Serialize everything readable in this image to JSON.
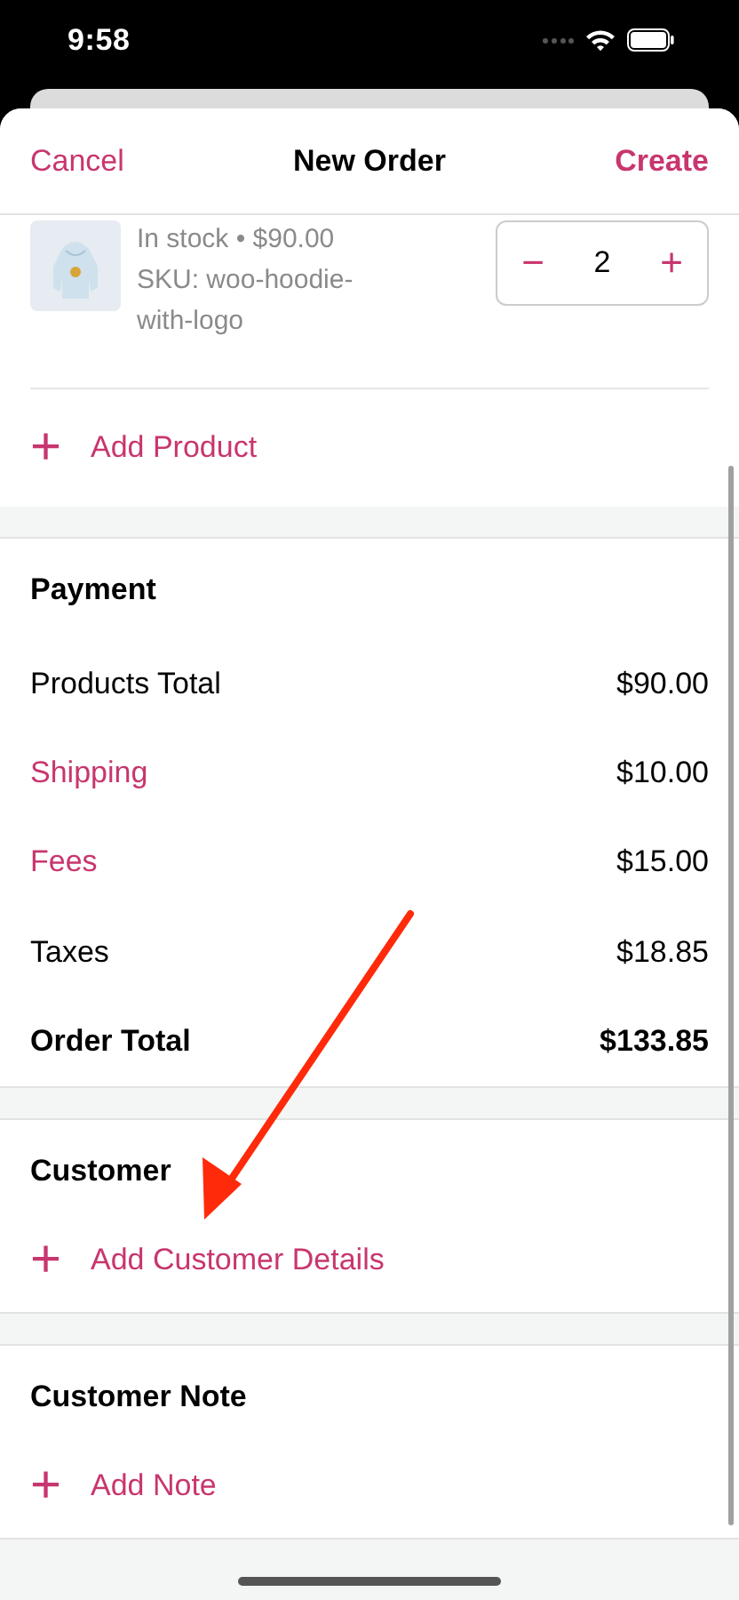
{
  "status_bar": {
    "time": "9:58"
  },
  "header": {
    "cancel": "Cancel",
    "title": "New Order",
    "create": "Create"
  },
  "product": {
    "stock": "In stock • $90.00",
    "sku": "SKU: woo-hoodie-with-logo",
    "quantity": "2",
    "decrement": "−",
    "increment": "+"
  },
  "add_product": {
    "icon": "+",
    "label": "Add Product"
  },
  "payment": {
    "title": "Payment",
    "rows": [
      {
        "kind": "plain",
        "label": "Products Total",
        "value": "$90.00"
      },
      {
        "kind": "link",
        "label": "Shipping",
        "value": "$10.00"
      },
      {
        "kind": "link",
        "label": "Fees",
        "value": "$15.00"
      },
      {
        "kind": "plain",
        "label": "Taxes",
        "value": "$18.85"
      },
      {
        "kind": "total",
        "label": "Order Total",
        "value": "$133.85"
      }
    ]
  },
  "customer": {
    "title": "Customer",
    "action": {
      "icon": "+",
      "label": "Add Customer Details"
    }
  },
  "customer_note": {
    "title": "Customer Note",
    "action": {
      "icon": "+",
      "label": "Add Note"
    }
  }
}
